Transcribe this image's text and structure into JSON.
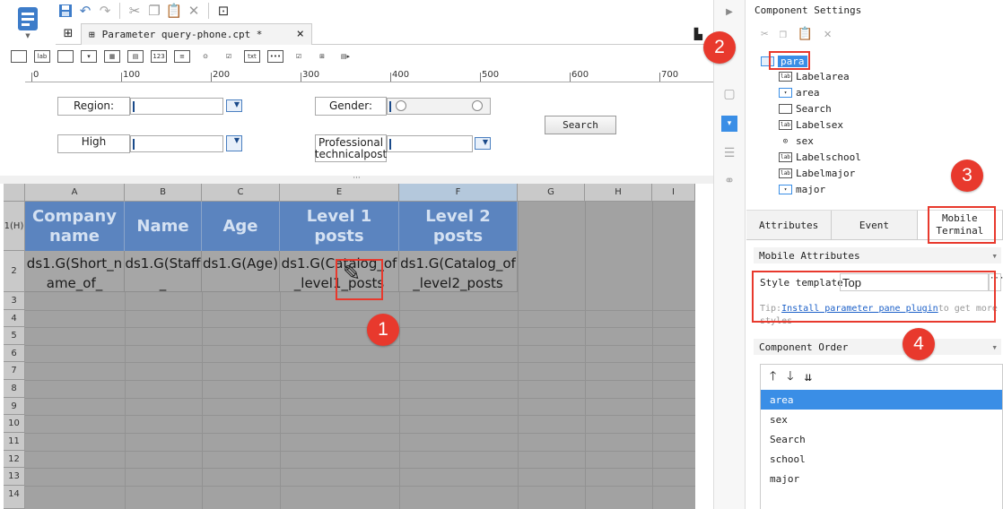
{
  "tab": {
    "title": "Parameter query-phone.cpt *",
    "close": "×"
  },
  "ruler_ticks": [
    "0",
    "100",
    "200",
    "300",
    "400",
    "500",
    "600",
    "700"
  ],
  "params": {
    "region_label": "Region:",
    "gender_label": "Gender:",
    "high_label": "High",
    "prof_label_1": "Professional",
    "prof_label_2": "technicalpost",
    "search_button": "Search"
  },
  "grid": {
    "columns": [
      "A",
      "B",
      "C",
      "E",
      "F",
      "G",
      "H",
      "I"
    ],
    "rows": [
      "1(H)",
      "2",
      "3",
      "4",
      "5",
      "6",
      "7",
      "8",
      "9",
      "10",
      "11",
      "12",
      "13",
      "14"
    ],
    "headers": [
      "Company name",
      "Name",
      "Age",
      "Level 1 posts",
      "Level 2 posts"
    ],
    "data": [
      "ds1.G(Short_name_of_",
      "ds1.G(Staff_",
      "ds1.G(Age)",
      "ds1.G(Catalog_of_level1_posts",
      "ds1.G(Catalog_of_level2_posts"
    ]
  },
  "panel": {
    "title": "Component Settings",
    "tree": [
      {
        "icon": "para-icon",
        "label": "para"
      },
      {
        "icon": "label-icon",
        "label": "Labelarea"
      },
      {
        "icon": "dropdown-icon",
        "label": "area"
      },
      {
        "icon": "button-icon",
        "label": "Search"
      },
      {
        "icon": "label-icon",
        "label": "Labelsex"
      },
      {
        "icon": "radio-icon",
        "label": "sex"
      },
      {
        "icon": "label-icon",
        "label": "Labelschool"
      },
      {
        "icon": "label-icon",
        "label": "Labelmajor"
      },
      {
        "icon": "dropdown-icon",
        "label": "major"
      }
    ],
    "tabs": {
      "attributes": "Attributes",
      "event": "Event",
      "mobile_1": "Mobile",
      "mobile_2": "Terminal"
    },
    "mobile_attributes": "Mobile Attributes",
    "style_template_label": "Style template",
    "style_template_value": "Top",
    "tip_prefix": "Tip:",
    "tip_link": "Install parameter pane plugin",
    "tip_suffix": "to get more styles",
    "component_order": "Component Order",
    "order_items": [
      "area",
      "sex",
      "Search",
      "school",
      "major"
    ]
  },
  "callouts": [
    "1",
    "2",
    "3",
    "4"
  ],
  "colors": {
    "header_blue": "#5b84bf",
    "selection": "#3a8ee6",
    "callout": "#e8392d"
  }
}
